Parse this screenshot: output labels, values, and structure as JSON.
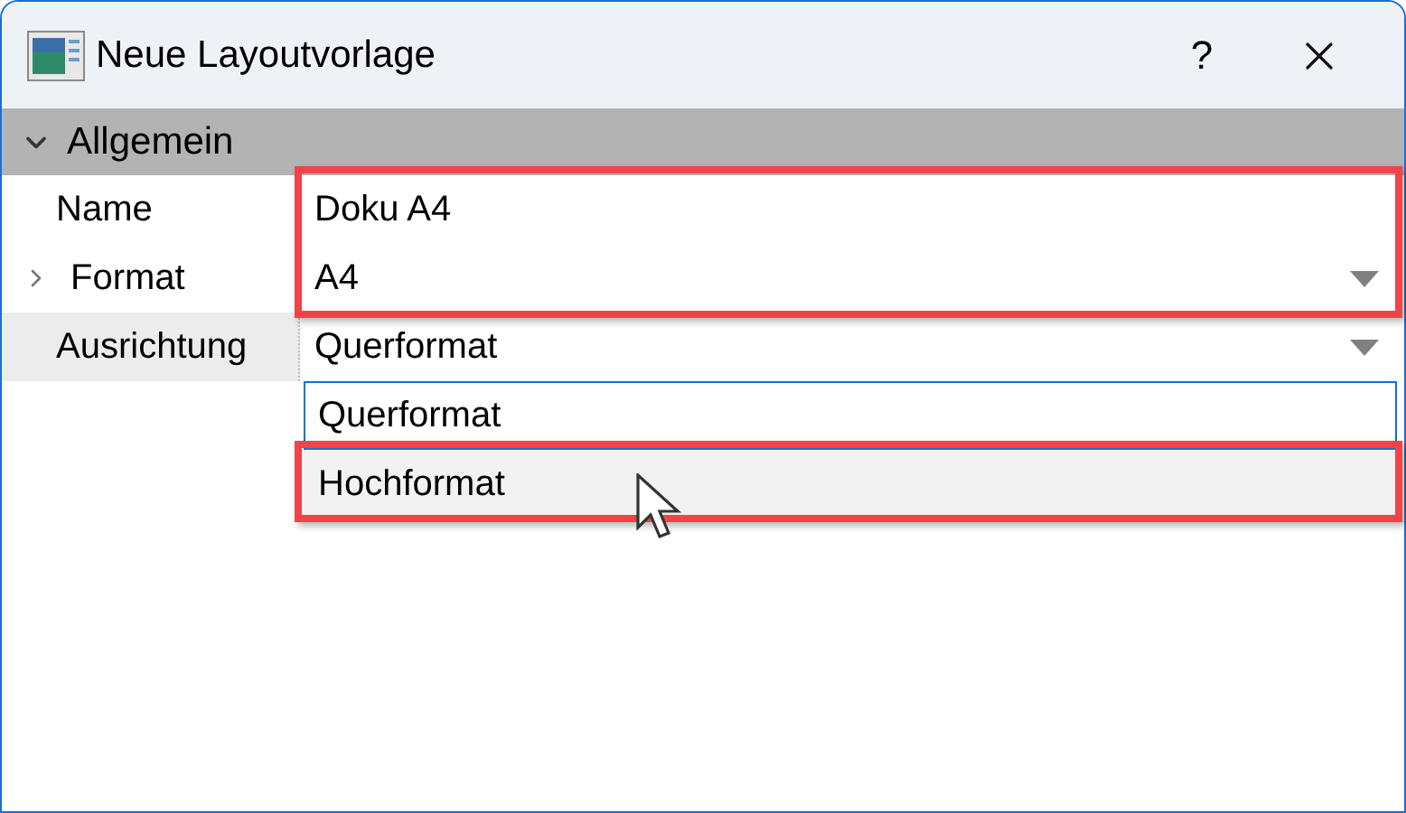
{
  "window": {
    "title": "Neue Layoutvorlage",
    "help": "?"
  },
  "group": {
    "title": "Allgemein",
    "expanded": true
  },
  "properties": [
    {
      "label": "Name",
      "value": "Doku A4",
      "kind": "text",
      "expandable": false,
      "current": false
    },
    {
      "label": "Format",
      "value": "A4",
      "kind": "dropdown",
      "expandable": true,
      "current": false
    },
    {
      "label": "Ausrichtung",
      "value": "Querformat",
      "kind": "dropdown",
      "expandable": false,
      "current": true
    }
  ],
  "dropdown_options": [
    {
      "label": "Querformat",
      "selected": true,
      "hovered": false
    },
    {
      "label": "Hochformat",
      "selected": false,
      "hovered": true
    }
  ]
}
